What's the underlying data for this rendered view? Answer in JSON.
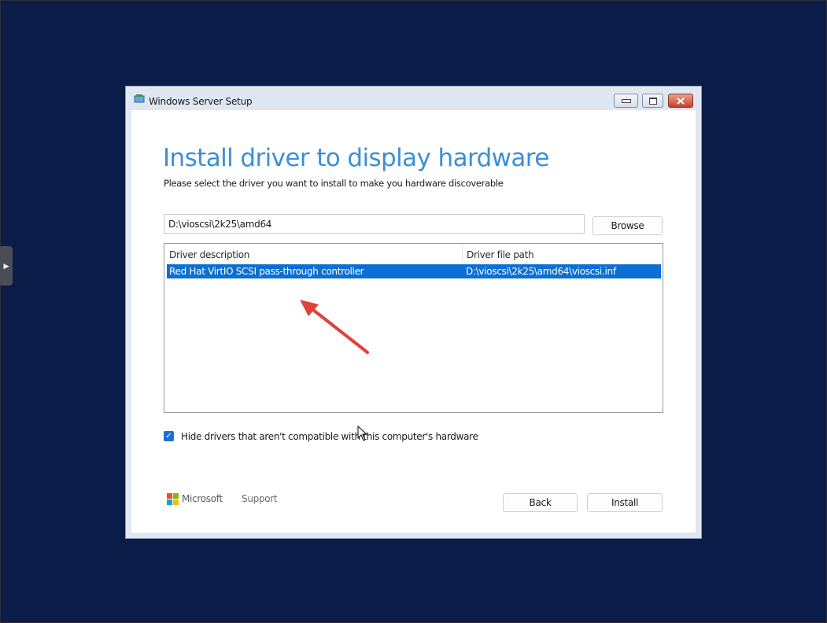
{
  "window": {
    "title": "Windows Server Setup",
    "icon": "setup-icon",
    "controls": [
      "minimize-icon",
      "maximize-icon",
      "close-icon"
    ]
  },
  "page": {
    "heading": "Install driver to display hardware",
    "subheading": "Please select the driver you want to install to make you hardware discoverable"
  },
  "path_field": {
    "value": "D:\\vioscsi\\2k25\\amd64"
  },
  "browse_label": "Browse",
  "driver_table": {
    "columns": [
      "Driver description",
      "Driver file path"
    ],
    "rows": [
      {
        "description": "Red Hat VirtIO SCSI pass-through controller",
        "path": "D:\\vioscsi\\2k25\\amd64\\vioscsi.inf",
        "selected": true
      }
    ]
  },
  "hide_incompatible": {
    "label": "Hide drivers that aren't compatible with this computer's hardware",
    "checked": true
  },
  "footer": {
    "brand": "Microsoft",
    "support_label": "Support",
    "back_label": "Back",
    "install_label": "Install"
  },
  "colors": {
    "desktop": "#0b1b45",
    "accent": "#3b8fd8",
    "selection": "#0b6fd3",
    "annotation_arrow": "#e0413a"
  }
}
